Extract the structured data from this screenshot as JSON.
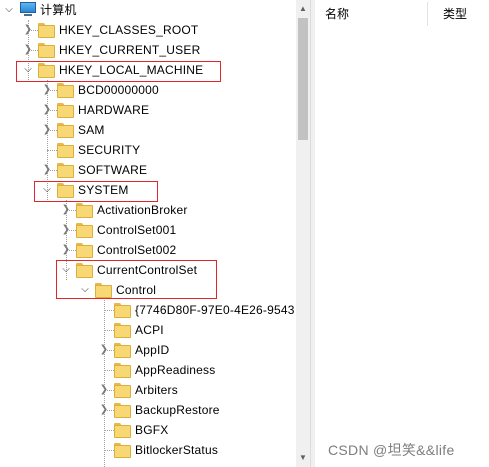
{
  "tree": {
    "root": "计算机",
    "hives": [
      "HKEY_CLASSES_ROOT",
      "HKEY_CURRENT_USER",
      "HKEY_LOCAL_MACHINE"
    ],
    "hklm_children": [
      "BCD00000000",
      "HARDWARE",
      "SAM",
      "SECURITY",
      "SOFTWARE",
      "SYSTEM"
    ],
    "system_children": [
      "ActivationBroker",
      "ControlSet001",
      "ControlSet002",
      "CurrentControlSet"
    ],
    "ccs_children": [
      "Control"
    ],
    "control_children": [
      "{7746D80F-97E0-4E26-9543",
      "ACPI",
      "AppID",
      "AppReadiness",
      "Arbiters",
      "BackupRestore",
      "BGFX",
      "BitlockerStatus"
    ]
  },
  "list": {
    "columns": [
      "名称",
      "类型"
    ]
  },
  "watermark": "CSDN @坦笑&&life",
  "colors": {
    "highlight_box": "#e0252b",
    "folder": "#f8d775",
    "scrollbar_thumb": "#c2c2c2"
  },
  "icons": {
    "root": "computer-icon",
    "node": "folder-icon",
    "collapsed": "chevron-right-icon",
    "expanded": "chevron-down-icon"
  }
}
